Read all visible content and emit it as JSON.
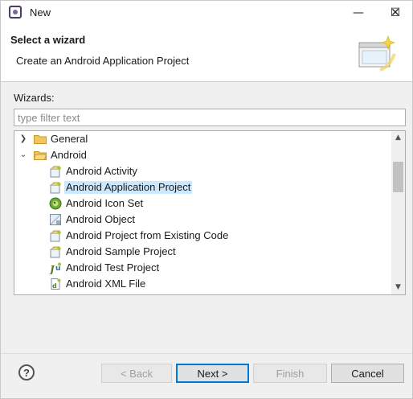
{
  "window": {
    "title": "New",
    "minimize_glyph": "—",
    "maximize_glyph": "☐",
    "close_glyph": "✕"
  },
  "header": {
    "title": "Select a wizard",
    "description": "Create an Android Application Project"
  },
  "wizards_label": "Wizards:",
  "filter": {
    "placeholder": "type filter text",
    "value": ""
  },
  "tree": {
    "groups": [
      {
        "label": "General",
        "expanded": false
      },
      {
        "label": "Android",
        "expanded": true
      }
    ],
    "items": [
      {
        "label": "Android Activity",
        "icon": "android-wizard-icon"
      },
      {
        "label": "Android Application Project",
        "icon": "android-wizard-icon",
        "selected": true
      },
      {
        "label": "Android Icon Set",
        "icon": "android-icon-set-icon"
      },
      {
        "label": "Android Object",
        "icon": "android-object-icon"
      },
      {
        "label": "Android Project from Existing Code",
        "icon": "android-wizard-icon"
      },
      {
        "label": "Android Sample Project",
        "icon": "android-wizard-icon"
      },
      {
        "label": "Android Test Project",
        "icon": "junit-icon"
      },
      {
        "label": "Android XML File",
        "icon": "xml-file-icon"
      }
    ]
  },
  "buttons": {
    "help": "?",
    "back": "< Back",
    "next": "Next >",
    "finish": "Finish",
    "cancel": "Cancel"
  },
  "colors": {
    "selection": "#cce8ff",
    "default_button_border": "#0078d7"
  }
}
